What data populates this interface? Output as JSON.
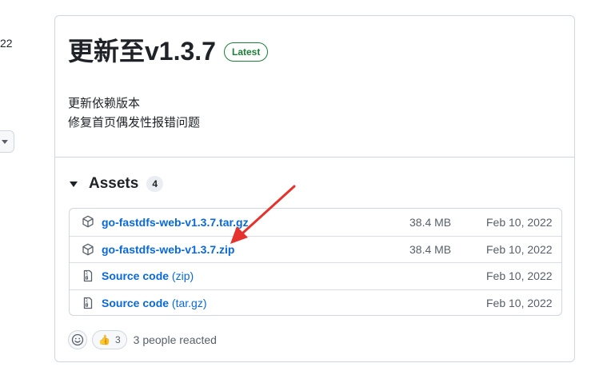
{
  "left_fragment": "22",
  "release": {
    "title": "更新至v1.3.7",
    "badge": "Latest",
    "notes": [
      "更新依赖版本",
      "修复首页偶发性报错问题"
    ]
  },
  "assets": {
    "heading": "Assets",
    "count": "4",
    "items": [
      {
        "name": "go-fastdfs-web-v1.3.7.tar.gz",
        "suffix": "",
        "size": "38.4 MB",
        "date": "Feb 10, 2022",
        "icon": "package-icon"
      },
      {
        "name": "go-fastdfs-web-v1.3.7.zip",
        "suffix": "",
        "size": "38.4 MB",
        "date": "Feb 10, 2022",
        "icon": "package-icon"
      },
      {
        "name": "Source code",
        "suffix": "(zip)",
        "size": "",
        "date": "Feb 10, 2022",
        "icon": "file-zip-icon"
      },
      {
        "name": "Source code",
        "suffix": "(tar.gz)",
        "size": "",
        "date": "Feb 10, 2022",
        "icon": "file-zip-icon"
      }
    ]
  },
  "reactions": {
    "emoji": "👍",
    "count": "3",
    "summary": "3 people reacted"
  },
  "colors": {
    "link": "#0969da",
    "latest_badge": "#1a7f37",
    "annotation_arrow": "#e5322d"
  }
}
